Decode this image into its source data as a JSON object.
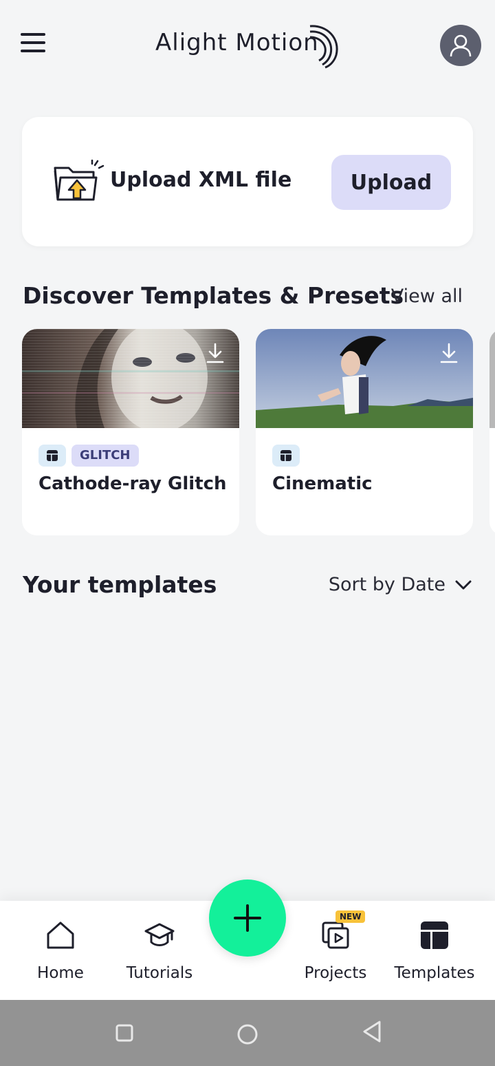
{
  "header": {
    "logo_text": "Alight Motion",
    "menu_icon": "hamburger-menu-icon",
    "avatar_icon": "user-icon"
  },
  "upload": {
    "title": "Upload XML file",
    "button_label": "Upload",
    "icon": "folder-upload-icon"
  },
  "discover": {
    "title": "Discover Templates & Presets",
    "view_all": "View all",
    "cards": [
      {
        "name": "Cathode-ray Glitch",
        "tag": "GLITCH",
        "type_icon": "template-icon",
        "download_icon": "download-icon"
      },
      {
        "name": "Cinematic",
        "tag": "",
        "type_icon": "template-icon",
        "download_icon": "download-icon"
      }
    ]
  },
  "your_templates": {
    "title": "Your templates",
    "sort_label": "Sort by Date",
    "sort_icon": "chevron-down-icon"
  },
  "bottom_nav": {
    "items": [
      {
        "label": "Home",
        "icon": "home-icon"
      },
      {
        "label": "Tutorials",
        "icon": "graduation-cap-icon"
      },
      {
        "label": "Projects",
        "icon": "projects-icon",
        "badge": "NEW"
      },
      {
        "label": "Templates",
        "icon": "templates-icon"
      }
    ],
    "fab_icon": "plus-icon"
  },
  "colors": {
    "background": "#f4f5f6",
    "accent_green": "#13f09a",
    "upload_button": "#dcdcf8",
    "badge_yellow": "#f8c23a"
  }
}
